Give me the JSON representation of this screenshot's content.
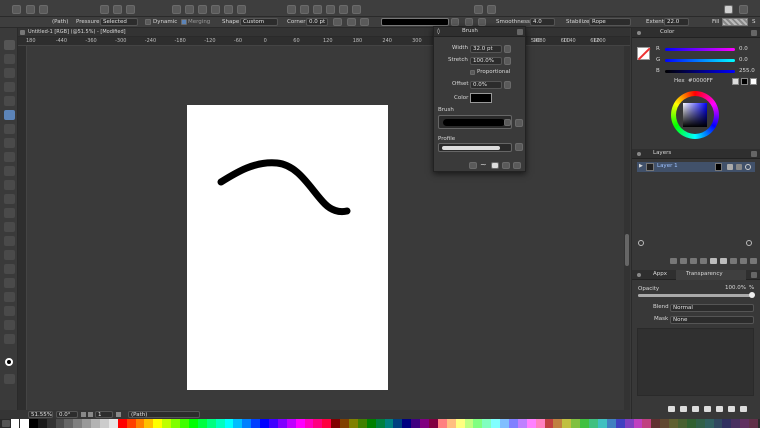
{
  "toolbar": {
    "target_label": "(Path)",
    "pressure_label": "Pressure",
    "pressure_value": "Selected",
    "dynamic_label": "Dynamic",
    "merging_label": "Merging",
    "shape_label": "Shape",
    "shape_value": "Custom",
    "corner_label": "Corner",
    "corner_value": "0.0 pt",
    "smoothness_label": "Smoothness",
    "smoothness_value": "4.0",
    "stabilize_label": "Stabilize",
    "stabilize_value": "Rope",
    "extent_label": "Extent",
    "extent_value": "22.0",
    "fill_label": "Fill",
    "s_label": "S"
  },
  "document_tab": {
    "title": "Untitled-1 [RGB] (@51.5%) - [Modified]"
  },
  "ruler": {
    "ticks": [
      "180",
      "-440",
      "-360",
      "-300",
      "-240",
      "-180",
      "-120",
      "-60",
      "0",
      "60",
      "120",
      "180",
      "240",
      "300",
      "360",
      "420",
      "480",
      "540",
      "600",
      "660",
      "1020",
      "1080",
      "1140",
      "1200"
    ]
  },
  "brush_popup": {
    "title": "Brush",
    "width_label": "Width",
    "width_value": "32.0 pt",
    "stretch_label": "Stretch",
    "stretch_value": "100.0%",
    "proportional_label": "Proportional",
    "offset_label": "Offset",
    "offset_value": "0.0%",
    "color_label": "Color",
    "brush_label": "Brush",
    "profile_label": "Profile"
  },
  "color_panel": {
    "title": "Color",
    "r_label": "R",
    "r_value": "0.0",
    "g_label": "G",
    "g_value": "0.0",
    "b_label": "B",
    "b_value": "255.0",
    "hex_label": "Hex",
    "hex_value": "#0000FF"
  },
  "layers_panel": {
    "title": "Layers",
    "layers": [
      {
        "name": "Layer 1"
      }
    ]
  },
  "appearance_panel": {
    "tab_appx": "Appx",
    "tab_transparency": "Transparency",
    "opacity_label": "Opacity",
    "opacity_value": "100.0%",
    "opacity_unit": "%",
    "blend_label": "Blend",
    "blend_value": "Normal",
    "mask_label": "Mask",
    "mask_value": "None"
  },
  "statusbar": {
    "zoom": "51.55%",
    "rotation": "0.0°",
    "page": "1",
    "selection": "(Path)"
  },
  "colors": {
    "accent": "#5c84b8",
    "canvas": "#ffffff",
    "stroke": "#000000",
    "hex_color": "#0000FF"
  },
  "palette": [
    "#ffffff",
    "#000000",
    "#1a1a1a",
    "#333333",
    "#4d4d4d",
    "#666666",
    "#808080",
    "#999999",
    "#b3b3b3",
    "#cccccc",
    "#e6e6e6",
    "#ff0000",
    "#ff4000",
    "#ff8000",
    "#ffbf00",
    "#ffff00",
    "#bfff00",
    "#80ff00",
    "#40ff00",
    "#00ff00",
    "#00ff40",
    "#00ff80",
    "#00ffbf",
    "#00ffff",
    "#00bfff",
    "#0080ff",
    "#0040ff",
    "#0000ff",
    "#4000ff",
    "#8000ff",
    "#bf00ff",
    "#ff00ff",
    "#ff00bf",
    "#ff0080",
    "#ff0040",
    "#800000",
    "#804000",
    "#808000",
    "#408000",
    "#008000",
    "#008040",
    "#008080",
    "#004080",
    "#000080",
    "#400080",
    "#800080",
    "#800040",
    "#ff8080",
    "#ffbf80",
    "#ffff80",
    "#bfff80",
    "#80ff80",
    "#80ffbf",
    "#80ffff",
    "#80bfff",
    "#8080ff",
    "#bf80ff",
    "#ff80ff",
    "#ff80bf",
    "#c04040",
    "#c08040",
    "#c0c040",
    "#80c040",
    "#40c040",
    "#40c080",
    "#40c0c0",
    "#4080c0",
    "#4040c0",
    "#8040c0",
    "#c040c0",
    "#c04080",
    "#603030",
    "#604830",
    "#606030",
    "#486030",
    "#306030",
    "#306048",
    "#306060",
    "#304860",
    "#303060",
    "#483060",
    "#603060",
    "#603048"
  ]
}
